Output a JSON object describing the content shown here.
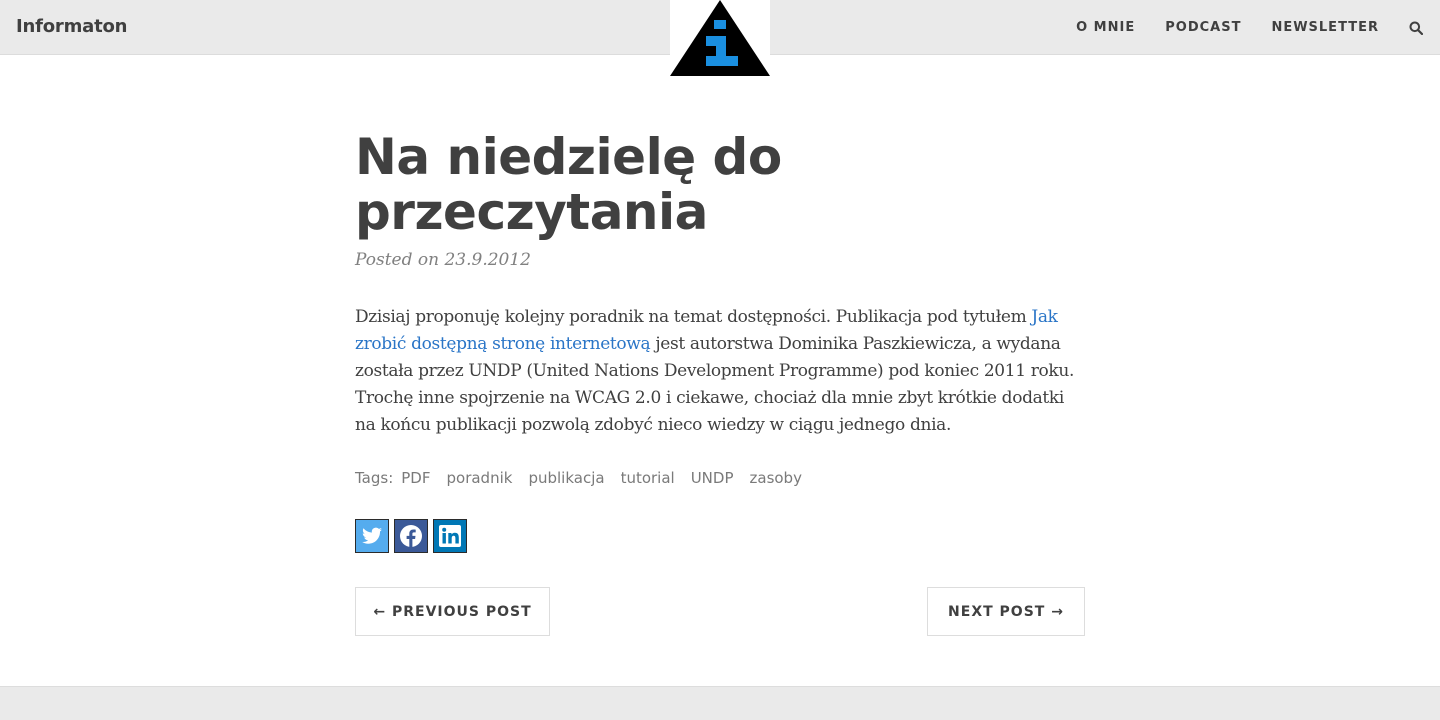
{
  "navbar": {
    "brand": "Informaton",
    "links": [
      "O MNIE",
      "PODCAST",
      "NEWSLETTER"
    ],
    "search_icon": "search-icon",
    "logo_icon": "info-triangle-logo"
  },
  "post": {
    "title": "Na niedzielę do przeczytania",
    "meta": "Posted on 23.9.2012",
    "body": {
      "before_link": "Dzisiaj proponuję kolejny poradnik na temat dostępności. Publikacja pod tytułem ",
      "link_text": "Jak zrobić dostępną stronę internetową",
      "after_link": " jest autorstwa Dominika Paszkiewicza, a wydana została przez UNDP (United Nations Development Programme) pod koniec 2011 roku. Trochę inne spojrzenie na WCAG 2.0 i ciekawe, chociaż dla mnie zbyt krótkie dodatki na końcu publikacji pozwolą zdobyć nieco wiedzy w ciągu jednego dnia."
    },
    "tags_label": "Tags:",
    "tags": [
      "PDF",
      "poradnik",
      "publikacja",
      "tutorial",
      "UNDP",
      "zasoby"
    ],
    "share": {
      "twitter_icon": "twitter-icon",
      "facebook_icon": "facebook-icon",
      "linkedin_icon": "linkedin-icon"
    }
  },
  "pager": {
    "previous": "← PREVIOUS POST",
    "next": "NEXT POST →"
  },
  "colors": {
    "navbar_bg": "#eaeaea",
    "link": "#2a75c7",
    "logo_blue": "#1a8fe0",
    "twitter": "#55acee",
    "facebook": "#3b5998",
    "linkedin": "#0077b5"
  }
}
